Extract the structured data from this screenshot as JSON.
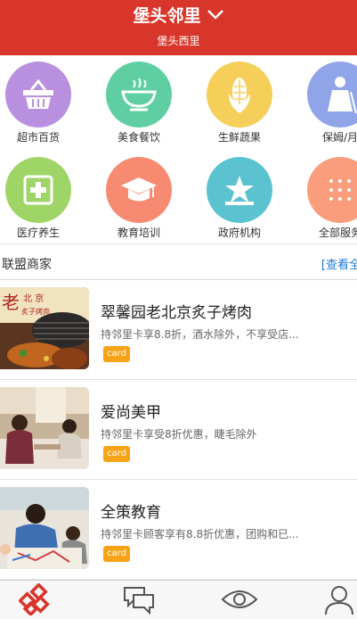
{
  "header": {
    "title": "堡头邻里",
    "subtitle": "堡头西里",
    "dropdown_icon": "chevron-down-icon"
  },
  "categories": [
    {
      "label": "超市百货",
      "icon": "basket-icon",
      "color": "#b98fe0"
    },
    {
      "label": "美食餐饮",
      "icon": "bowl-icon",
      "color": "#5fcfa3"
    },
    {
      "label": "生鲜蔬果",
      "icon": "corn-icon",
      "color": "#f5cf5a"
    },
    {
      "label": "保姆/月",
      "icon": "housekeeper-icon",
      "color": "#8fa5e8"
    },
    {
      "label": "医疗养生",
      "icon": "medical-icon",
      "color": "#9fd467"
    },
    {
      "label": "教育培训",
      "icon": "graduation-cap-icon",
      "color": "#f78b72"
    },
    {
      "label": "政府机构",
      "icon": "emblem-icon",
      "color": "#5bc2cf"
    },
    {
      "label": "全部服务",
      "icon": "grid-dots-icon",
      "color": "#f99d7c"
    }
  ],
  "section": {
    "title": "联盟商家",
    "more_label": "[查看全"
  },
  "merchants": [
    {
      "name": "翠馨园老北京炙子烤肉",
      "desc": "持邻里卡享8.8折，酒水除外，不享受店...",
      "badge": "card"
    },
    {
      "name": "爱尚美甲",
      "desc": "持邻里卡享受8折优惠，睫毛除外",
      "badge": "card"
    },
    {
      "name": "全策教育",
      "desc": "持邻里卡顾客享有8.8折优惠，团购和已...",
      "badge": "card"
    }
  ],
  "thumb_text": {
    "big": "老",
    "line1": "北 京",
    "line2": "炙子烤肉"
  },
  "tabbar": {
    "items": [
      "home-icon",
      "chat-icon",
      "eye-icon",
      "user-icon"
    ],
    "active_color": "#d9362b"
  }
}
